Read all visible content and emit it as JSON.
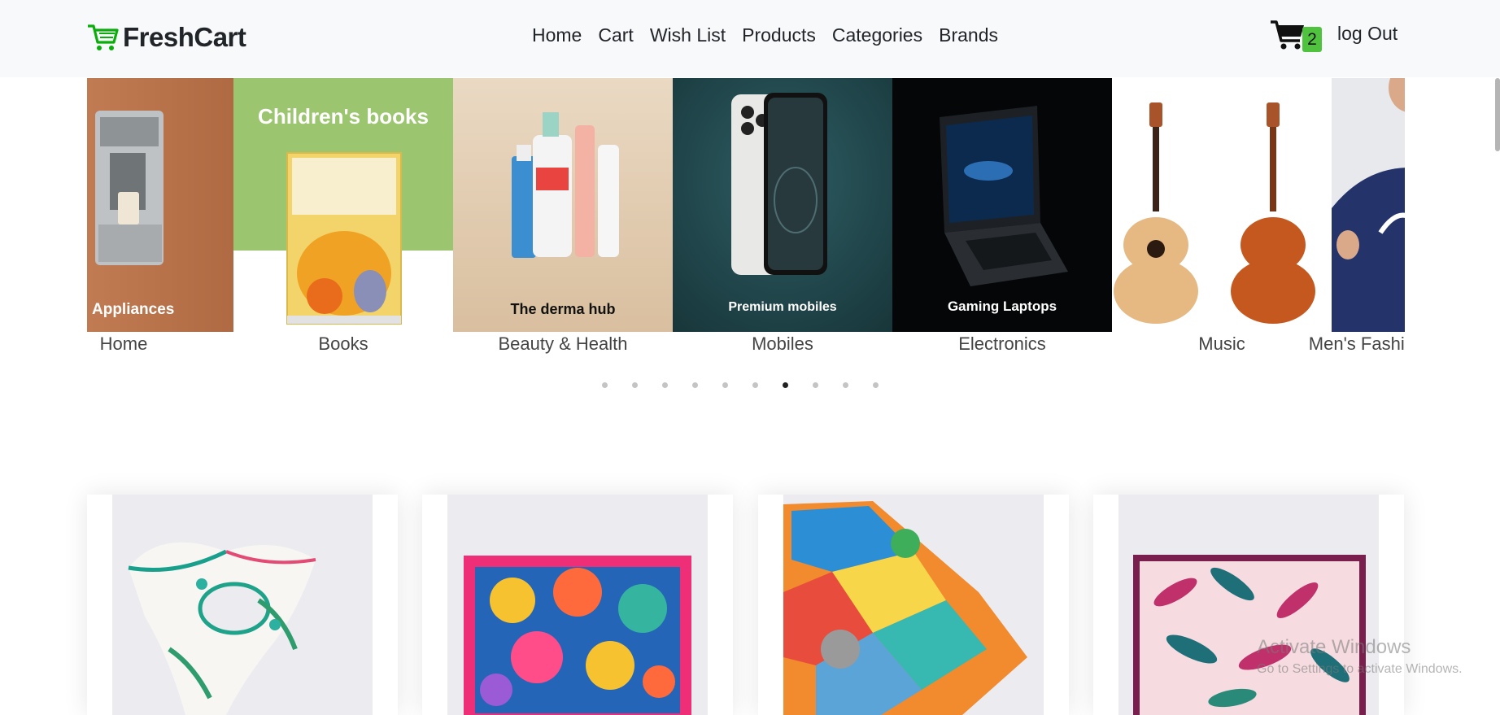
{
  "brand": {
    "name": "FreshCart",
    "icon": "cart-logo-icon",
    "color": "#0aad0a"
  },
  "nav": {
    "links": [
      "Home",
      "Cart",
      "Wish List",
      "Products",
      "Categories",
      "Brands"
    ],
    "cart_count": "2",
    "logout_label": "log Out"
  },
  "slider": {
    "slides": [
      {
        "label": "Home",
        "image_text": "Appliances"
      },
      {
        "label": "Books",
        "image_text": "Children's books"
      },
      {
        "label": "Beauty & Health",
        "image_text": "The derma hub"
      },
      {
        "label": "Mobiles",
        "image_text": "Premium mobiles"
      },
      {
        "label": "Electronics",
        "image_text": "Gaming Laptops"
      },
      {
        "label": "Music",
        "image_text": ""
      },
      {
        "label": "Men's Fashion",
        "image_text": ""
      }
    ],
    "dot_count": 10,
    "active_dot": 6
  },
  "products": [
    {
      "image": "white-green-floral-scarf"
    },
    {
      "image": "multicolor-floral-square-scarf"
    },
    {
      "image": "geometric-patterned-scarf"
    },
    {
      "image": "pink-leaf-print-scarf"
    }
  ],
  "overlay": {
    "title": "Activate Windows",
    "subtitle": "Go to Settings to activate Windows."
  },
  "colors": {
    "accent": "#0aad0a",
    "badge": "#4fc23e",
    "navbar_bg": "#f8f9fa"
  }
}
